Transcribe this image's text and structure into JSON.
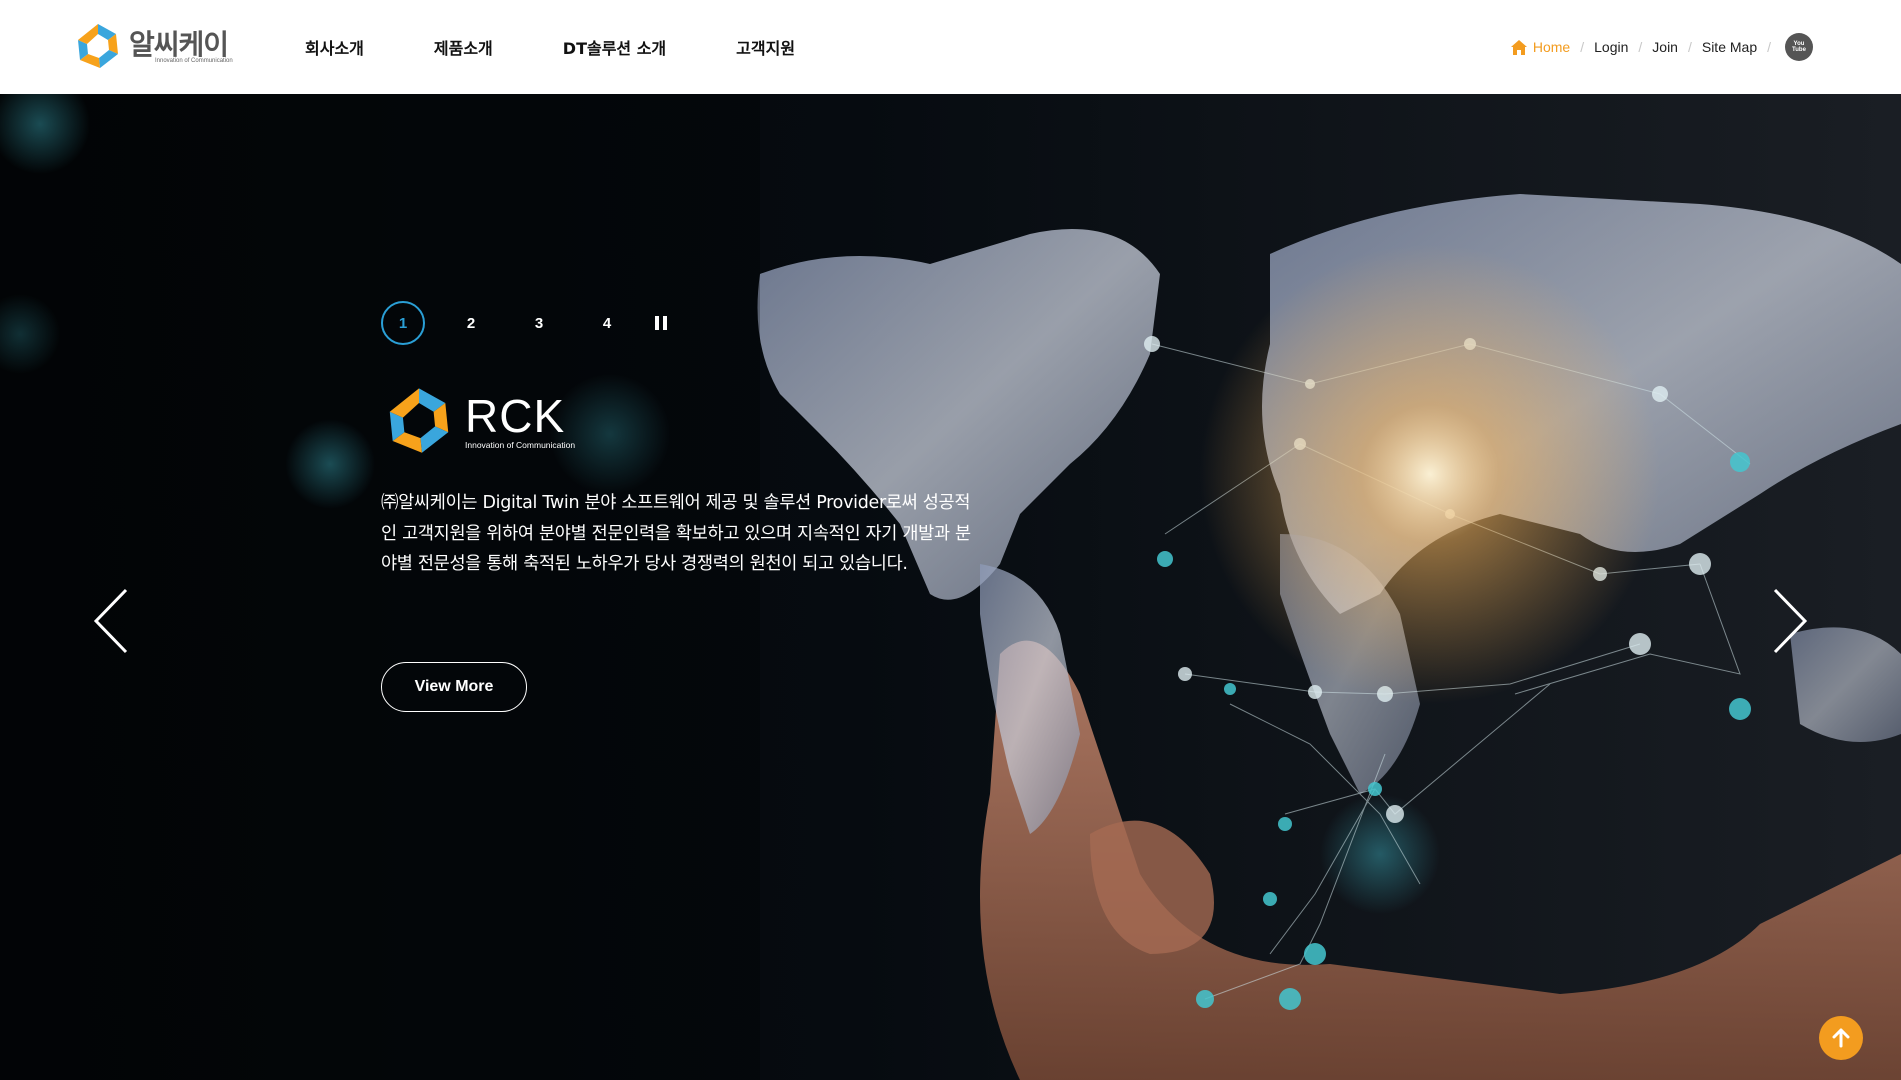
{
  "header": {
    "logo": {
      "name": "알씨케이",
      "tagline": "Innovation of Communication"
    },
    "nav": [
      {
        "label": "회사소개"
      },
      {
        "label": "제품소개"
      },
      {
        "label": "DT솔루션 소개"
      },
      {
        "label": "고객지원"
      }
    ],
    "util": {
      "home": "Home",
      "login": "Login",
      "join": "Join",
      "sitemap": "Site Map",
      "separator": "/",
      "youtube_icon": "youtube-icon",
      "youtube_text_top": "You",
      "youtube_text_bottom": "Tube"
    }
  },
  "hero": {
    "pager": {
      "pages": [
        "1",
        "2",
        "3",
        "4"
      ],
      "active": "1",
      "pause_icon": "pause-icon"
    },
    "logo": {
      "name": "RCK",
      "tagline": "Innovation of Communication"
    },
    "description": "㈜알씨케이는 Digital Twin 분야 소프트웨어 제공 및 솔루션 Provider로써 성공적인 고객지원을 위하여 분야별 전문인력을 확보하고 있으며 지속적인 자기 개발과 분야별 전문성을 통해 축적된 노하우가 당사 경쟁력의 원천이 되고 있습니다.",
    "cta": "View More",
    "prev_icon": "chevron-left-icon",
    "next_icon": "chevron-right-icon"
  },
  "colors": {
    "accent": "#f39c1f",
    "pager_active": "#2a9fd6",
    "logo_blue": "#3aa6dd",
    "logo_orange": "#f7a21b"
  },
  "scroll_top_icon": "arrow-up-icon"
}
